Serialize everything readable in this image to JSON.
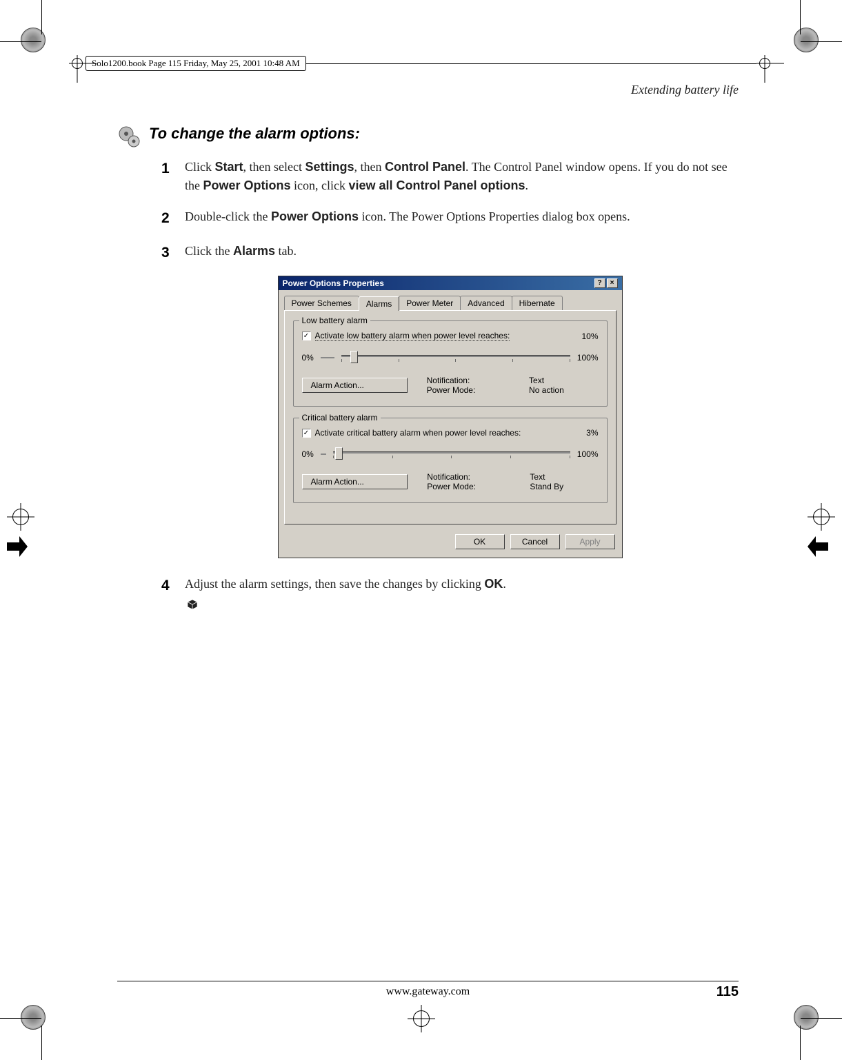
{
  "meta": {
    "header_stamp": "Solo1200.book  Page 115  Friday, May 25, 2001  10:48 AM"
  },
  "page": {
    "section_title": "Extending battery life",
    "procedure_title": "To change the alarm options:",
    "steps": {
      "s1": {
        "num": "1",
        "parts": {
          "a": "Click ",
          "b": "Start",
          "c": ", then select ",
          "d": "Settings",
          "e": ", then ",
          "f": "Control Panel",
          "g": ". The Control Panel window opens. If you do not see the ",
          "h": "Power Options",
          "i": " icon, click ",
          "j": "view all Control Panel options",
          "k": "."
        }
      },
      "s2": {
        "num": "2",
        "parts": {
          "a": "Double-click the ",
          "b": "Power Options",
          "c": " icon. The Power Options Properties dialog box opens."
        }
      },
      "s3": {
        "num": "3",
        "parts": {
          "a": "Click the ",
          "b": "Alarms",
          "c": " tab."
        }
      },
      "s4": {
        "num": "4",
        "parts": {
          "a": "Adjust the alarm settings, then save the changes by clicking ",
          "b": "OK",
          "c": "."
        }
      }
    }
  },
  "dialog": {
    "title": "Power Options Properties",
    "help_btn": "?",
    "close_btn": "×",
    "tabs": {
      "schemes": "Power Schemes",
      "alarms": "Alarms",
      "meter": "Power Meter",
      "advanced": "Advanced",
      "hibernate": "Hibernate"
    },
    "low": {
      "group_title": "Low battery alarm",
      "checkbox_label": "Activate low battery alarm when power level reaches:",
      "value": "10%",
      "min": "0%",
      "max": "100%",
      "action_btn": "Alarm Action...",
      "notif_label": "Notification:",
      "notif_value": "Text",
      "power_label": "Power Mode:",
      "power_value": "No action"
    },
    "crit": {
      "group_title": "Critical battery alarm",
      "checkbox_label": "Activate critical battery alarm when power level reaches:",
      "value": "3%",
      "min": "0%",
      "max": "100%",
      "action_btn": "Alarm Action...",
      "notif_label": "Notification:",
      "notif_value": "Text",
      "power_label": "Power Mode:",
      "power_value": "Stand By"
    },
    "buttons": {
      "ok": "OK",
      "cancel": "Cancel",
      "apply": "Apply"
    }
  },
  "footer": {
    "url": "www.gateway.com",
    "page_num": "115"
  }
}
